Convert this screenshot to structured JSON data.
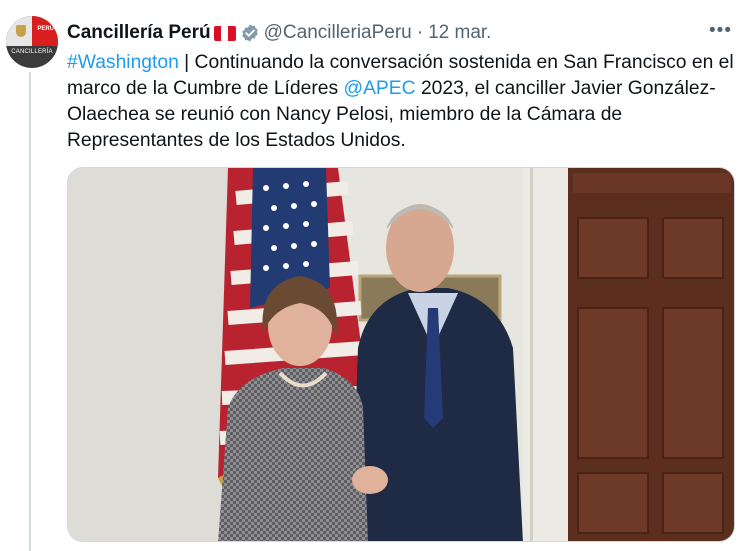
{
  "author": {
    "display_name": "Cancillería Perú",
    "handle": "@CancilleriaPeru",
    "separator": "·",
    "time": "12 mar.",
    "avatar_top_text": "PERÚ",
    "avatar_text": "CANCILLERÍA",
    "flag_colors": [
      "#d91023",
      "#ffffff",
      "#d91023"
    ],
    "verified_color": "#829aab"
  },
  "more_label": "•••",
  "body": {
    "hashtag": "#Washington",
    "part1": " | Continuando la conversación sostenida en San Francisco en el marco de la Cumbre de Líderes ",
    "mention": "@APEC",
    "part2": " 2023, el canciller Javier González-Olaechea se reunió con Nancy Pelosi, miembro de la Cámara de Representantes de los Estados Unidos."
  },
  "colors": {
    "link": "#1d9bf0",
    "text": "#0f1419",
    "secondary": "#536471"
  },
  "media": {
    "icon": "photo-image"
  }
}
